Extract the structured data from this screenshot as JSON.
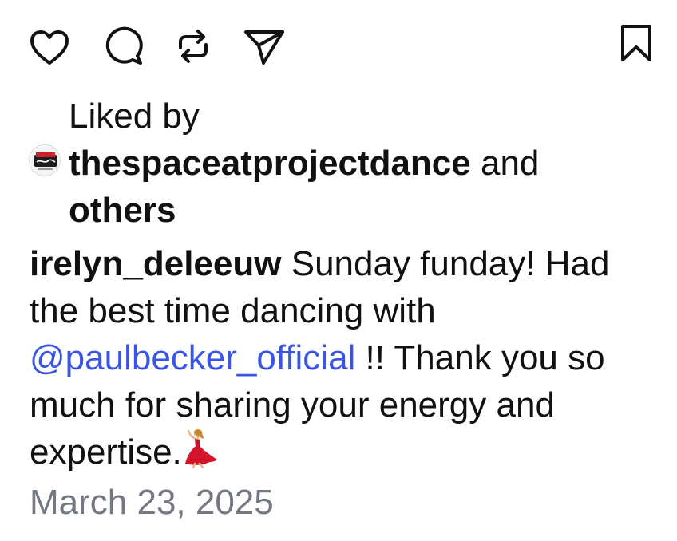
{
  "actions": {
    "like_icon": "heart-icon",
    "comment_icon": "comment-bubble-icon",
    "repost_icon": "repost-icon",
    "share_icon": "paper-plane-icon",
    "save_icon": "bookmark-icon"
  },
  "likes": {
    "prefix": "Liked by",
    "username": "thespaceatprojectdance",
    "connector": "and",
    "others": "others",
    "avatar_icon": "profile-avatar"
  },
  "caption": {
    "username": "irelyn_deleeuw",
    "text_before_mention": "Sunday funday! Had the best time dancing with",
    "mention": "@paulbecker_official",
    "text_after_mention": "!! Thank you so much for sharing your energy and expertise.",
    "emoji": "dancing-woman-emoji"
  },
  "post": {
    "date": "March 23, 2025"
  },
  "colors": {
    "text": "#111111",
    "mention": "#3a55e6",
    "date": "#737883"
  }
}
